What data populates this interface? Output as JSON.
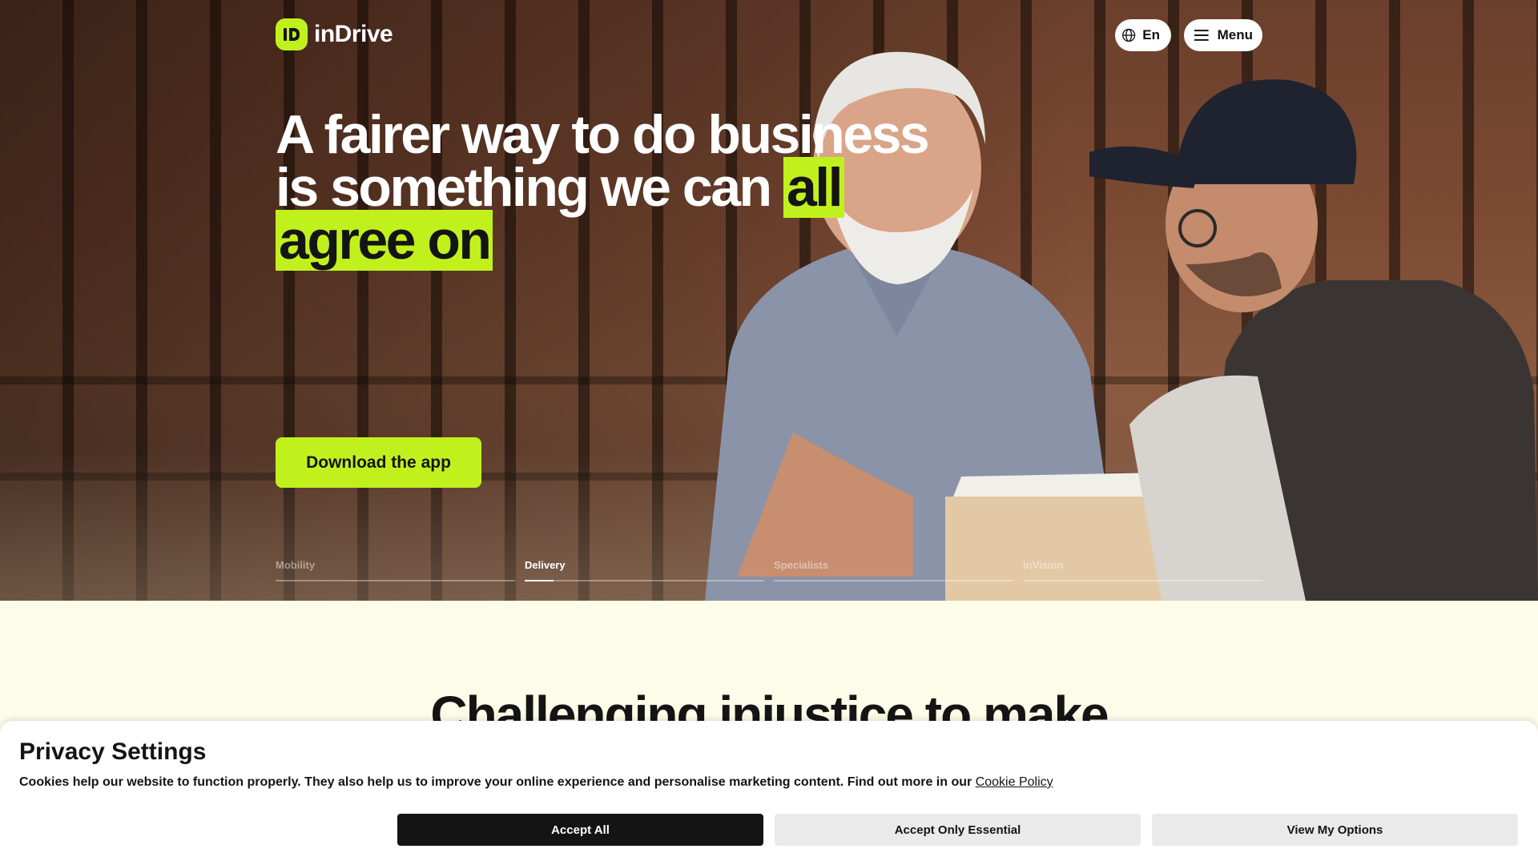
{
  "brand": {
    "name": "inDrive",
    "accent": "#c1f11d",
    "dark": "#141414",
    "logo_icon": "indrive-logo-icon"
  },
  "header": {
    "language": {
      "label": "En",
      "icon": "globe-icon"
    },
    "menu": {
      "label": "Menu",
      "icon": "hamburger-icon"
    }
  },
  "hero": {
    "headline_plain": "A fairer way to do business is something we can ",
    "headline_highlight_1": "all",
    "headline_highlight_2": "agree on",
    "cta_label": "Download the app",
    "tabs": [
      {
        "label": "Mobility",
        "active": false,
        "progress": 0
      },
      {
        "label": "Delivery",
        "active": true,
        "progress": 0.12
      },
      {
        "label": "Specialists",
        "active": false,
        "progress": 0
      },
      {
        "label": "inVision",
        "active": false,
        "progress": 0
      }
    ]
  },
  "section": {
    "title": "Challenging injustice to make"
  },
  "cookie_banner": {
    "title": "Privacy Settings",
    "text": "Cookies help our website to function properly. They also help us to improve your online experience and personalise marketing content. Find out more in our",
    "link_label": "Cookie Policy",
    "buttons": {
      "accept_all": "Accept All",
      "accept_essential": "Accept Only Essential",
      "view_options": "View My Options"
    }
  }
}
